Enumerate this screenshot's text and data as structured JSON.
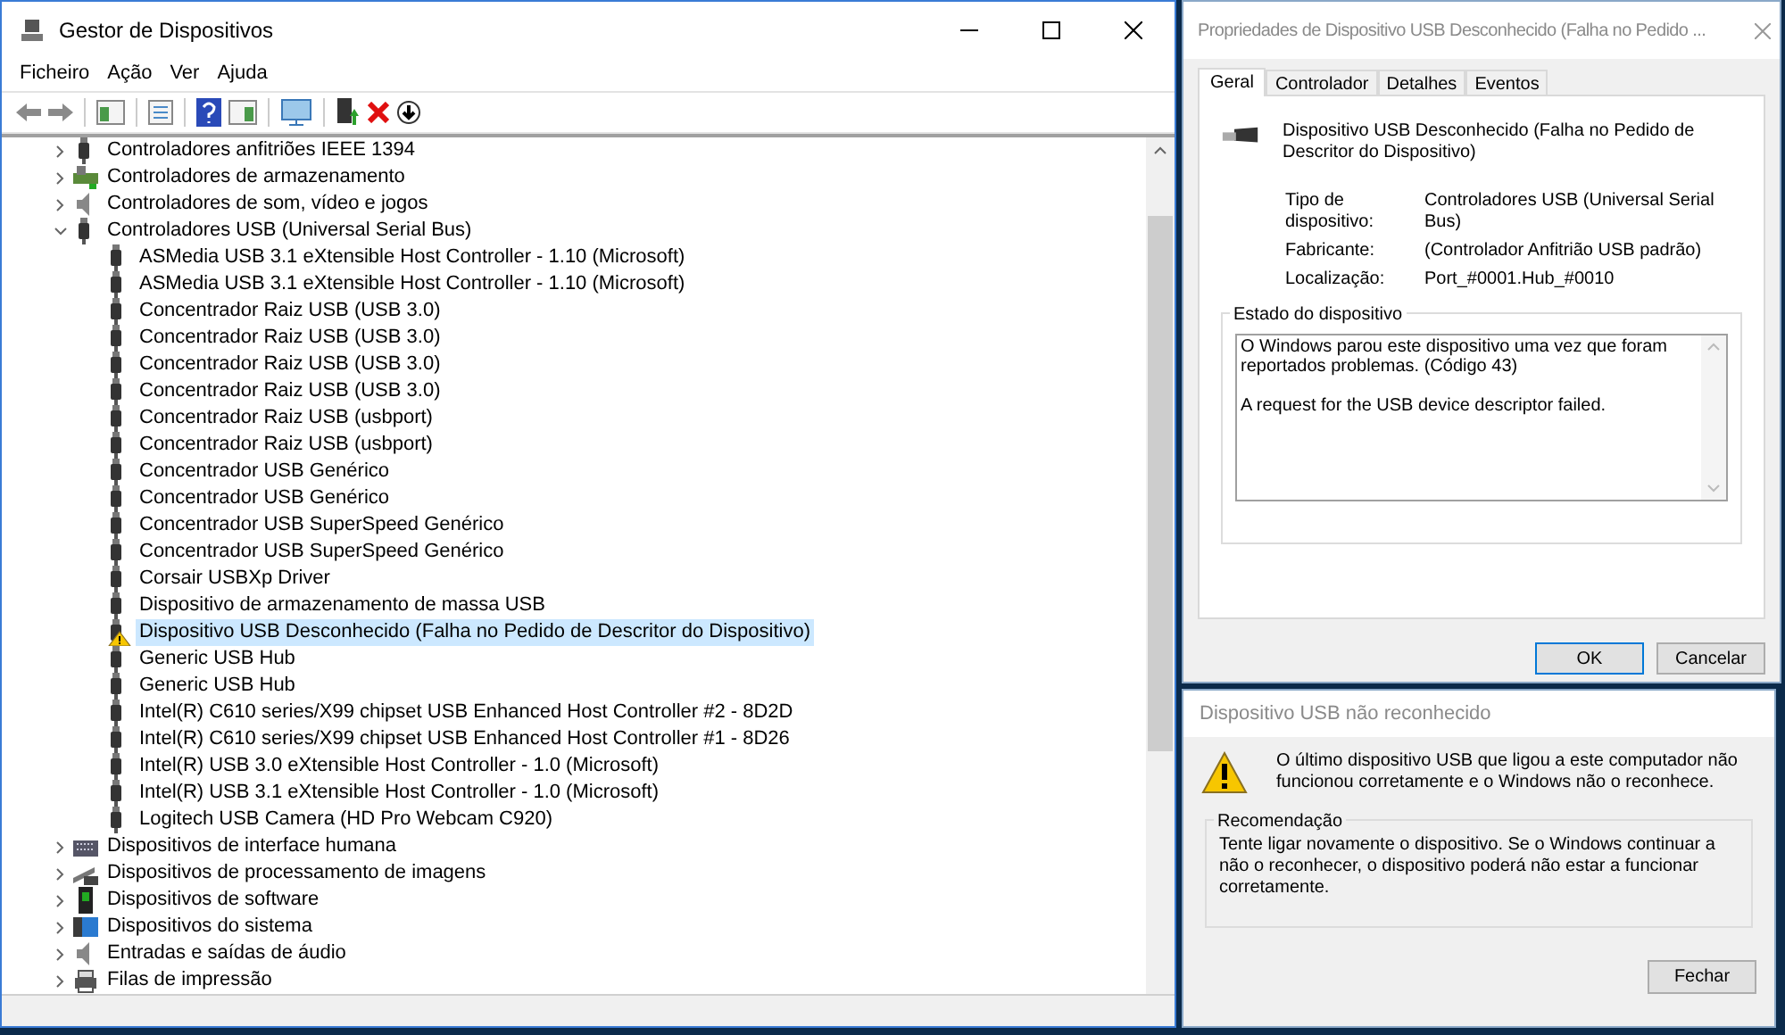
{
  "device_manager": {
    "title": "Gestor de Dispositivos",
    "menu": [
      "Ficheiro",
      "Ação",
      "Ver",
      "Ajuda"
    ],
    "tree": [
      {
        "label": "Controladores anfitriões IEEE 1394",
        "kind": "usb",
        "expanded": false,
        "selected": false
      },
      {
        "label": "Controladores de armazenamento",
        "kind": "storage",
        "expanded": false,
        "selected": false
      },
      {
        "label": "Controladores de som, vídeo e jogos",
        "kind": "sound",
        "expanded": false,
        "selected": false
      },
      {
        "label": "Controladores USB (Universal Serial Bus)",
        "kind": "usb",
        "expanded": true,
        "selected": false,
        "children": [
          {
            "label": "ASMedia USB 3.1 eXtensible Host Controller - 1.10 (Microsoft)",
            "kind": "usb",
            "selected": false
          },
          {
            "label": "ASMedia USB 3.1 eXtensible Host Controller - 1.10 (Microsoft)",
            "kind": "usb",
            "selected": false
          },
          {
            "label": "Concentrador Raiz USB (USB 3.0)",
            "kind": "usb",
            "selected": false
          },
          {
            "label": "Concentrador Raiz USB (USB 3.0)",
            "kind": "usb",
            "selected": false
          },
          {
            "label": "Concentrador Raiz USB (USB 3.0)",
            "kind": "usb",
            "selected": false
          },
          {
            "label": "Concentrador Raiz USB (USB 3.0)",
            "kind": "usb",
            "selected": false
          },
          {
            "label": "Concentrador Raiz USB (usbport)",
            "kind": "usb",
            "selected": false
          },
          {
            "label": "Concentrador Raiz USB (usbport)",
            "kind": "usb",
            "selected": false
          },
          {
            "label": "Concentrador USB Genérico",
            "kind": "usb",
            "selected": false
          },
          {
            "label": "Concentrador USB Genérico",
            "kind": "usb",
            "selected": false
          },
          {
            "label": "Concentrador USB SuperSpeed Genérico",
            "kind": "usb",
            "selected": false
          },
          {
            "label": "Concentrador USB SuperSpeed Genérico",
            "kind": "usb",
            "selected": false
          },
          {
            "label": "Corsair USBXp Driver",
            "kind": "usb",
            "selected": false
          },
          {
            "label": "Dispositivo de armazenamento de massa USB",
            "kind": "usb",
            "selected": false
          },
          {
            "label": "Dispositivo USB Desconhecido (Falha no Pedido de Descritor do Dispositivo)",
            "kind": "usb-warning",
            "selected": true
          },
          {
            "label": "Generic USB Hub",
            "kind": "usb",
            "selected": false
          },
          {
            "label": "Generic USB Hub",
            "kind": "usb",
            "selected": false
          },
          {
            "label": "Intel(R) C610 series/X99 chipset USB Enhanced Host Controller #2 - 8D2D",
            "kind": "usb",
            "selected": false
          },
          {
            "label": "Intel(R) C610 series/X99 chipset USB Enhanced Host Controller #1 - 8D26",
            "kind": "usb",
            "selected": false
          },
          {
            "label": "Intel(R) USB 3.0 eXtensible Host Controller - 1.0 (Microsoft)",
            "kind": "usb",
            "selected": false
          },
          {
            "label": "Intel(R) USB 3.1 eXtensible Host Controller - 1.0 (Microsoft)",
            "kind": "usb",
            "selected": false
          },
          {
            "label": "Logitech USB Camera (HD Pro Webcam C920)",
            "kind": "usb",
            "selected": false
          }
        ]
      },
      {
        "label": "Dispositivos de interface humana",
        "kind": "hid",
        "expanded": false,
        "selected": false
      },
      {
        "label": "Dispositivos de processamento de imagens",
        "kind": "imaging",
        "expanded": false,
        "selected": false
      },
      {
        "label": "Dispositivos de software",
        "kind": "software",
        "expanded": false,
        "selected": false
      },
      {
        "label": "Dispositivos do sistema",
        "kind": "system",
        "expanded": false,
        "selected": false
      },
      {
        "label": "Entradas e saídas de áudio",
        "kind": "sound",
        "expanded": false,
        "selected": false
      },
      {
        "label": "Filas de impressão",
        "kind": "printer",
        "expanded": false,
        "selected": false
      }
    ]
  },
  "properties_dialog": {
    "title": "Propriedades de Dispositivo USB Desconhecido (Falha no Pedido ...",
    "tabs": [
      {
        "label": "Geral",
        "selected": true
      },
      {
        "label": "Controlador",
        "selected": false
      },
      {
        "label": "Detalhes",
        "selected": false
      },
      {
        "label": "Eventos",
        "selected": false
      }
    ],
    "device_name": "Dispositivo USB Desconhecido (Falha no Pedido de Descritor do Dispositivo)",
    "fields": [
      {
        "label": "Tipo de dispositivo:",
        "value": "Controladores USB (Universal Serial Bus)"
      },
      {
        "label": "Fabricante:",
        "value": "(Controlador Anfitrião USB padrão)"
      },
      {
        "label": "Localização:",
        "value": "Port_#0001.Hub_#0010"
      }
    ],
    "status_group": "Estado do dispositivo",
    "status_text": "O Windows parou este dispositivo uma vez que foram reportados problemas. (Código 43)\n\nA request for the USB device descriptor failed.",
    "buttons": [
      "OK",
      "Cancelar"
    ]
  },
  "usb_dialog": {
    "title": "Dispositivo USB não reconhecido",
    "message": "O último dispositivo USB que ligou a este computador não funcionou corretamente e o Windows não o reconhece.",
    "group": "Recomendação",
    "recommendation": "Tente ligar novamente o dispositivo. Se o Windows continuar a não o reconhecer, o dispositivo poderá não estar a funcionar corretamente.",
    "button": "Fechar"
  }
}
